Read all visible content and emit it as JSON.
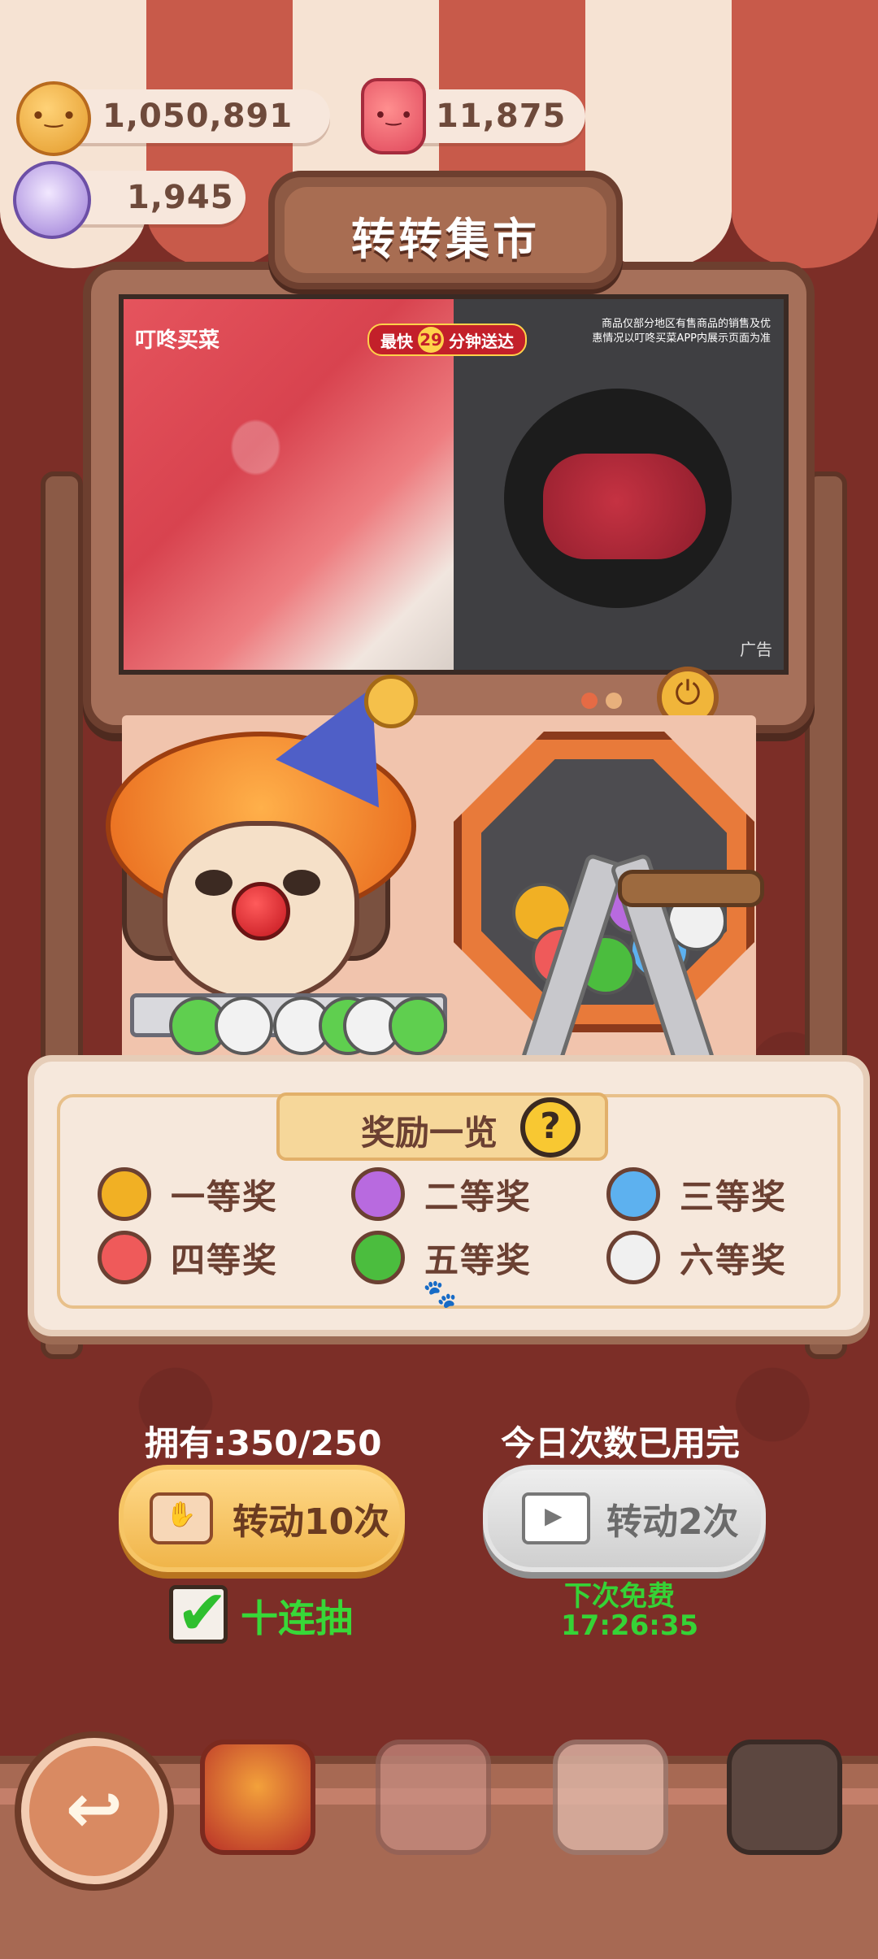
{
  "currencies": {
    "coins": {
      "icon": "cookie-coin-icon",
      "value": "1,050,891"
    },
    "jars": {
      "icon": "red-jar-icon",
      "value": "11,875"
    },
    "candy": {
      "icon": "candy-icon",
      "value": "1,945"
    }
  },
  "title": "转转集市",
  "ad": {
    "brand": "叮咚买菜",
    "speed_prefix": "最快",
    "speed_num": "29",
    "speed_suffix": "分钟送达",
    "disclaimer": "商品仅部分地区有售商品的销售及优惠情况以叮咚买菜APP内展示页面为准",
    "label": "广告"
  },
  "rewards": {
    "title": "奖励一览",
    "items": [
      {
        "name": "一等奖",
        "color": "#f1b024"
      },
      {
        "name": "二等奖",
        "color": "#b86adf"
      },
      {
        "name": "三等奖",
        "color": "#5db1ef"
      },
      {
        "name": "四等奖",
        "color": "#ef5a5a"
      },
      {
        "name": "五等奖",
        "color": "#4bbd3e"
      },
      {
        "name": "六等奖",
        "color": "#f0f0f0"
      }
    ]
  },
  "spin": {
    "owned_label": "拥有:350/250",
    "spin10_label": "转动10次",
    "daily_status": "今日次数已用完",
    "spin2_label": "转动2次",
    "ten_pull_label": "十连抽",
    "ten_pull_checked": true,
    "next_free_label": "下次免费",
    "next_free_timer": "17:26:35"
  },
  "nav": {
    "back": "back-arrow-icon",
    "items": [
      "circus-icon",
      "rabbit-icon",
      "house-icon",
      "mystery-icon"
    ]
  }
}
